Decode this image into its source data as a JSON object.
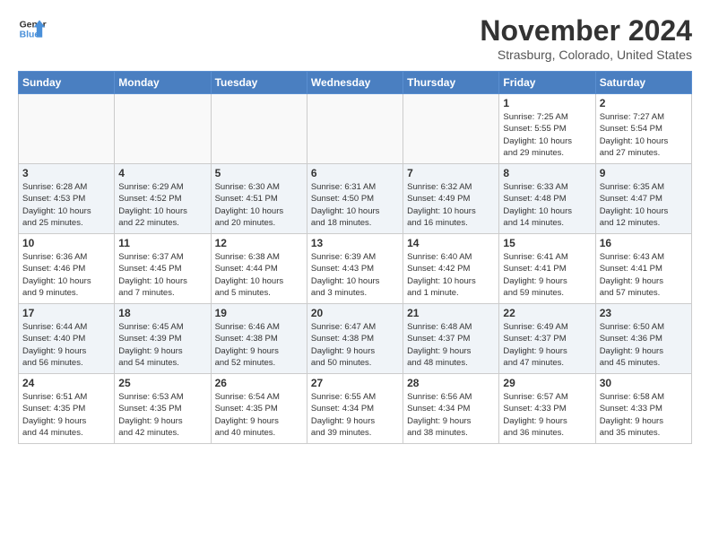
{
  "logo": {
    "line1": "General",
    "line2": "Blue"
  },
  "title": "November 2024",
  "location": "Strasburg, Colorado, United States",
  "weekdays": [
    "Sunday",
    "Monday",
    "Tuesday",
    "Wednesday",
    "Thursday",
    "Friday",
    "Saturday"
  ],
  "weeks": [
    [
      {
        "day": "",
        "info": ""
      },
      {
        "day": "",
        "info": ""
      },
      {
        "day": "",
        "info": ""
      },
      {
        "day": "",
        "info": ""
      },
      {
        "day": "",
        "info": ""
      },
      {
        "day": "1",
        "info": "Sunrise: 7:25 AM\nSunset: 5:55 PM\nDaylight: 10 hours\nand 29 minutes."
      },
      {
        "day": "2",
        "info": "Sunrise: 7:27 AM\nSunset: 5:54 PM\nDaylight: 10 hours\nand 27 minutes."
      }
    ],
    [
      {
        "day": "3",
        "info": "Sunrise: 6:28 AM\nSunset: 4:53 PM\nDaylight: 10 hours\nand 25 minutes."
      },
      {
        "day": "4",
        "info": "Sunrise: 6:29 AM\nSunset: 4:52 PM\nDaylight: 10 hours\nand 22 minutes."
      },
      {
        "day": "5",
        "info": "Sunrise: 6:30 AM\nSunset: 4:51 PM\nDaylight: 10 hours\nand 20 minutes."
      },
      {
        "day": "6",
        "info": "Sunrise: 6:31 AM\nSunset: 4:50 PM\nDaylight: 10 hours\nand 18 minutes."
      },
      {
        "day": "7",
        "info": "Sunrise: 6:32 AM\nSunset: 4:49 PM\nDaylight: 10 hours\nand 16 minutes."
      },
      {
        "day": "8",
        "info": "Sunrise: 6:33 AM\nSunset: 4:48 PM\nDaylight: 10 hours\nand 14 minutes."
      },
      {
        "day": "9",
        "info": "Sunrise: 6:35 AM\nSunset: 4:47 PM\nDaylight: 10 hours\nand 12 minutes."
      }
    ],
    [
      {
        "day": "10",
        "info": "Sunrise: 6:36 AM\nSunset: 4:46 PM\nDaylight: 10 hours\nand 9 minutes."
      },
      {
        "day": "11",
        "info": "Sunrise: 6:37 AM\nSunset: 4:45 PM\nDaylight: 10 hours\nand 7 minutes."
      },
      {
        "day": "12",
        "info": "Sunrise: 6:38 AM\nSunset: 4:44 PM\nDaylight: 10 hours\nand 5 minutes."
      },
      {
        "day": "13",
        "info": "Sunrise: 6:39 AM\nSunset: 4:43 PM\nDaylight: 10 hours\nand 3 minutes."
      },
      {
        "day": "14",
        "info": "Sunrise: 6:40 AM\nSunset: 4:42 PM\nDaylight: 10 hours\nand 1 minute."
      },
      {
        "day": "15",
        "info": "Sunrise: 6:41 AM\nSunset: 4:41 PM\nDaylight: 9 hours\nand 59 minutes."
      },
      {
        "day": "16",
        "info": "Sunrise: 6:43 AM\nSunset: 4:41 PM\nDaylight: 9 hours\nand 57 minutes."
      }
    ],
    [
      {
        "day": "17",
        "info": "Sunrise: 6:44 AM\nSunset: 4:40 PM\nDaylight: 9 hours\nand 56 minutes."
      },
      {
        "day": "18",
        "info": "Sunrise: 6:45 AM\nSunset: 4:39 PM\nDaylight: 9 hours\nand 54 minutes."
      },
      {
        "day": "19",
        "info": "Sunrise: 6:46 AM\nSunset: 4:38 PM\nDaylight: 9 hours\nand 52 minutes."
      },
      {
        "day": "20",
        "info": "Sunrise: 6:47 AM\nSunset: 4:38 PM\nDaylight: 9 hours\nand 50 minutes."
      },
      {
        "day": "21",
        "info": "Sunrise: 6:48 AM\nSunset: 4:37 PM\nDaylight: 9 hours\nand 48 minutes."
      },
      {
        "day": "22",
        "info": "Sunrise: 6:49 AM\nSunset: 4:37 PM\nDaylight: 9 hours\nand 47 minutes."
      },
      {
        "day": "23",
        "info": "Sunrise: 6:50 AM\nSunset: 4:36 PM\nDaylight: 9 hours\nand 45 minutes."
      }
    ],
    [
      {
        "day": "24",
        "info": "Sunrise: 6:51 AM\nSunset: 4:35 PM\nDaylight: 9 hours\nand 44 minutes."
      },
      {
        "day": "25",
        "info": "Sunrise: 6:53 AM\nSunset: 4:35 PM\nDaylight: 9 hours\nand 42 minutes."
      },
      {
        "day": "26",
        "info": "Sunrise: 6:54 AM\nSunset: 4:35 PM\nDaylight: 9 hours\nand 40 minutes."
      },
      {
        "day": "27",
        "info": "Sunrise: 6:55 AM\nSunset: 4:34 PM\nDaylight: 9 hours\nand 39 minutes."
      },
      {
        "day": "28",
        "info": "Sunrise: 6:56 AM\nSunset: 4:34 PM\nDaylight: 9 hours\nand 38 minutes."
      },
      {
        "day": "29",
        "info": "Sunrise: 6:57 AM\nSunset: 4:33 PM\nDaylight: 9 hours\nand 36 minutes."
      },
      {
        "day": "30",
        "info": "Sunrise: 6:58 AM\nSunset: 4:33 PM\nDaylight: 9 hours\nand 35 minutes."
      }
    ]
  ]
}
